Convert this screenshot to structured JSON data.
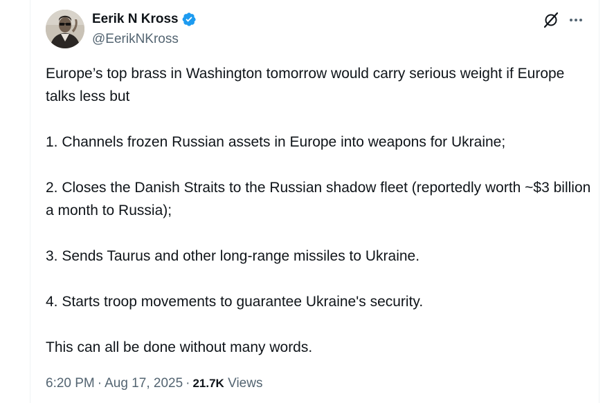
{
  "author": {
    "display_name": "Eerik N Kross",
    "handle": "@EerikNKross",
    "verified": true
  },
  "tweet": {
    "paragraphs": [
      "Europe’s top brass in Washington tomorrow would carry serious weight if Europe talks less but",
      "1. Channels frozen Russian assets in Europe into weapons for Ukraine;",
      "2. Closes the Danish Straits to the Russian shadow fleet (reportedly worth ~$3 billion a month to Russia);",
      "3. Sends Taurus and other long-range missiles to Ukraine.",
      "4. Starts troop movements to guarantee Ukraine's security.",
      "This can all be done without many words."
    ],
    "time": "6:20 PM",
    "date": "Aug 17, 2025",
    "separator": "·",
    "views_count": "21.7K",
    "views_label": "Views"
  },
  "icons": {
    "verified": "verified-badge-icon",
    "grok": "grok-icon",
    "more": "more-icon"
  },
  "colors": {
    "verified_blue": "#1d9bf0",
    "text_primary": "#0f1419",
    "text_secondary": "#536471"
  }
}
